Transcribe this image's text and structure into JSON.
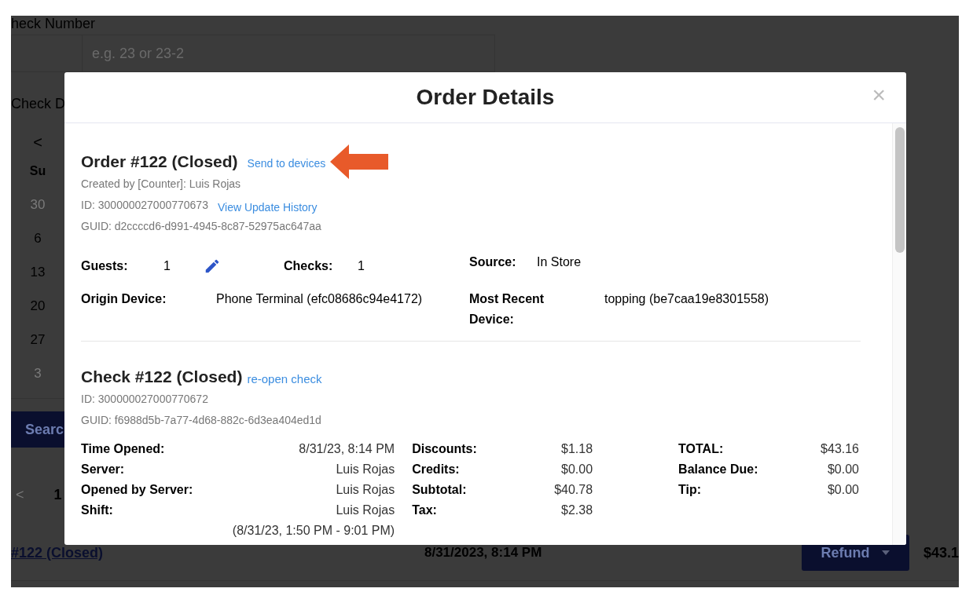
{
  "background_page": {
    "check_number_label": "heck Number",
    "check_number_placeholder": "e.g. 23 or 23-2",
    "check_date_label": "Check D",
    "calendar": {
      "prev": "<",
      "weekday": "Su",
      "days": [
        {
          "label": "30",
          "outside_month": true
        },
        {
          "label": "6",
          "outside_month": false
        },
        {
          "label": "13",
          "outside_month": false
        },
        {
          "label": "20",
          "outside_month": false
        },
        {
          "label": "27",
          "outside_month": false
        },
        {
          "label": "3",
          "outside_month": true
        }
      ]
    },
    "search_button": "Searc",
    "pagination": {
      "prev": "<",
      "pages": [
        {
          "label": "1",
          "selected": true
        }
      ]
    },
    "row": {
      "order_link": "#122 (Closed)",
      "date": "8/31/2023, 8:14 PM",
      "refund_button": "Refund",
      "amount": "$43.1"
    }
  },
  "modal": {
    "title": "Order Details",
    "close": "×",
    "order": {
      "title": "Order #122 (Closed)",
      "action_link": "Send to devices",
      "created_by": "Created by [Counter]: Luis Rojas",
      "id": "ID: 300000027000770673",
      "history_link": "View Update History",
      "guid": "GUID: d2ccccd6-d991-4945-8c87-52975ac647aa",
      "summary": [
        {
          "label": "Guests:",
          "value": "1",
          "editable": true
        },
        {
          "label": "Checks:",
          "value": "1",
          "editable": false
        },
        {
          "label": "Source:",
          "value": "In Store",
          "editable": false
        }
      ],
      "devices": [
        {
          "label": "Origin Device:",
          "value": "Phone Terminal (efc08686c94e4172)"
        },
        {
          "label": "Most Recent Device:",
          "value": "topping (be7caa19e8301558)"
        }
      ]
    },
    "check": {
      "title": "Check #122 (Closed)",
      "action_link": "re-open check",
      "id": "ID: 300000027000770672",
      "guid": "GUID: f6988d5b-7a77-4d68-882c-6d3ea404ed1d",
      "columns": [
        [
          {
            "label": "Time Opened:",
            "value": "8/31/23, 8:14 PM"
          },
          {
            "label": "Server:",
            "value": "Luis Rojas"
          },
          {
            "label": "Opened by Server:",
            "value": "Luis Rojas"
          },
          {
            "label": "Shift:",
            "value": "Luis Rojas",
            "note": "(8/31/23, 1:50 PM - 9:01 PM)"
          }
        ],
        [
          {
            "label": "Discounts:",
            "value": "$1.18"
          },
          {
            "label": "Credits:",
            "value": "$0.00"
          },
          {
            "label": "Subtotal:",
            "value": "$40.78"
          },
          {
            "label": "Tax:",
            "value": "$2.38"
          }
        ],
        [
          {
            "label": "TOTAL:",
            "value": "$43.16"
          },
          {
            "label": "Balance Due:",
            "value": "$0.00"
          },
          {
            "label": "Tip:",
            "value": "$0.00"
          }
        ]
      ]
    }
  }
}
